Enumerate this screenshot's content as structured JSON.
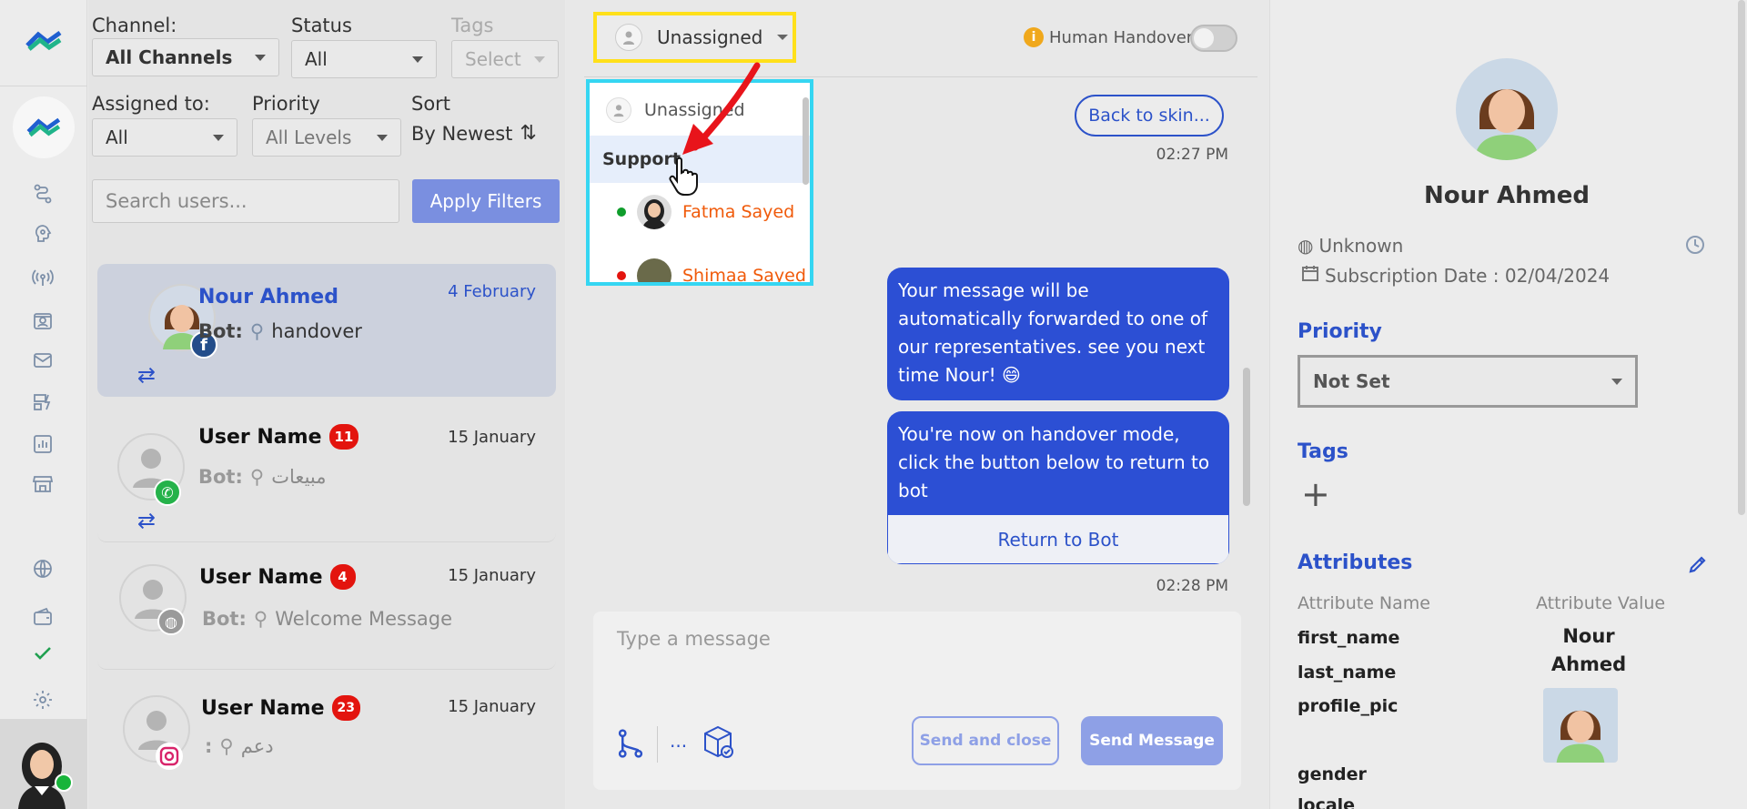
{
  "rail": {
    "icons": [
      "flow-icon",
      "ai-brain-icon",
      "broadcast-icon",
      "contacts-icon",
      "mail-icon",
      "campaign-icon",
      "analytics-icon",
      "store-icon",
      "globe-icon",
      "wallet-icon",
      "check-icon",
      "gear-icon"
    ]
  },
  "filters": {
    "channel_label": "Channel:",
    "channel_value": "All Channels",
    "status_label": "Status",
    "status_value": "All",
    "tags_label": "Tags",
    "tags_placeholder": "Select",
    "assigned_label": "Assigned to:",
    "assigned_value": "All",
    "priority_label": "Priority",
    "priority_value": "All Levels",
    "sort_label": "Sort",
    "sort_value": "By Newest",
    "search_placeholder": "Search users...",
    "apply_label": "Apply Filters"
  },
  "conversations": [
    {
      "name": "Nour Ahmed",
      "date": "4 February",
      "bot_prefix": "Bot:",
      "bot_text": "handover",
      "channel": "facebook"
    },
    {
      "name": "User Name",
      "unread": "11",
      "date": "15 January",
      "bot_prefix": "Bot:",
      "bot_text": "مبيعات",
      "channel": "whatsapp"
    },
    {
      "name": "User Name",
      "unread": "4",
      "date": "15 January",
      "bot_prefix": "Bot:",
      "bot_text": "Welcome Message",
      "channel": "web"
    },
    {
      "name": "User Name",
      "unread": "23",
      "date": "15 January",
      "bot_prefix": ":",
      "bot_text": "دعم",
      "channel": "instagram"
    }
  ],
  "chat": {
    "assign_value": "Unassigned",
    "handover_label": "Human Handover",
    "dropdown": {
      "unassigned": "Unassigned",
      "group": "Support",
      "agents": [
        "Fatma Sayed",
        "Shimaa Sayed"
      ]
    },
    "back_button": "Back to skin...",
    "time1": "02:27 PM",
    "msg1": "Your message will be automatically forwarded to one of our representatives. see you next time Nour! 😄",
    "msg2": "You're now on handover mode, click the button below to return to bot",
    "return_bot": "Return to Bot",
    "time2": "02:28 PM",
    "input_placeholder": "Type a message",
    "more": "...",
    "send_close": "Send and close",
    "send_message": "Send Message"
  },
  "profile": {
    "name": "Nour Ahmed",
    "location": "Unknown",
    "subscription": "Subscription Date : 02/04/2024",
    "priority_title": "Priority",
    "priority_value": "Not Set",
    "tags_title": "Tags",
    "attributes_title": "Attributes",
    "col_name": "Attribute Name",
    "col_value": "Attribute Value",
    "attrs": [
      "first_name",
      "last_name",
      "profile_pic",
      "gender",
      "locale"
    ],
    "first_name_value": "Nour Ahmed"
  },
  "colors": {
    "accent": "#2c52c9",
    "bubble": "#2c4fd4",
    "highlight_yellow": "#ffe01a",
    "highlight_cyan": "#35d6f2",
    "arrow_red": "#e8141b"
  }
}
